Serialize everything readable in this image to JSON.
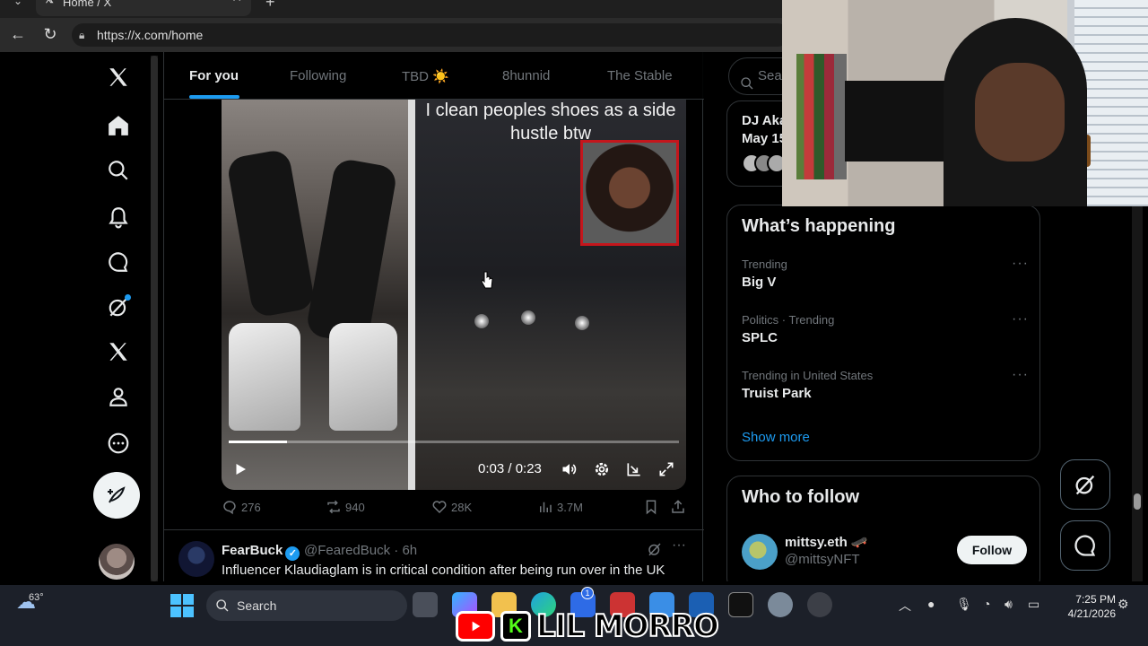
{
  "browser": {
    "tab_title": "Home / X",
    "url": "https://x.com/home"
  },
  "feed_tabs": [
    {
      "label": "For you",
      "active": true
    },
    {
      "label": "Following",
      "active": false
    },
    {
      "label": "TBD ☀️",
      "active": false
    },
    {
      "label": "8hunnid",
      "active": false
    },
    {
      "label": "The Stable",
      "active": false
    }
  ],
  "video_post": {
    "caption": "I clean peoples shoes as a side hustle btw",
    "time_display": "0:03 / 0:23",
    "progress": 0.13,
    "replies": "276",
    "reposts": "940",
    "likes": "28K",
    "views": "3.7M"
  },
  "tweet2": {
    "name": "FearBuck",
    "handle": "@FearedBuck",
    "time": "· 6h",
    "text": "Influencer Klaudiaglam is in critical condition after being run over in the UK"
  },
  "right": {
    "search_placeholder": "Sear",
    "spaces_line1": "DJ Aka",
    "spaces_line2": "May 15",
    "whats_happening": {
      "title": "What’s happening",
      "trends": [
        {
          "meta": "Trending",
          "topic": "Big V"
        },
        {
          "meta": "Politics · Trending",
          "topic": "SPLC"
        },
        {
          "meta": "Trending in United States",
          "topic": "Truist Park"
        }
      ],
      "show_more": "Show more"
    },
    "who_to_follow": {
      "title": "Who to follow",
      "name": "mittsy.eth 🛹",
      "handle": "@mittsyNFT",
      "button": "Follow"
    }
  },
  "taskbar": {
    "weather_temp": "63°",
    "search_label": "Search",
    "time": "7:25 PM",
    "date": "4/21/2026",
    "badge_count": "1"
  },
  "overlay": {
    "brand_text": "LIL MORRO"
  },
  "colors": {
    "accent": "#1d9bf0",
    "background": "#000000",
    "text_primary": "#e7e9ea",
    "text_secondary": "#71767b"
  }
}
